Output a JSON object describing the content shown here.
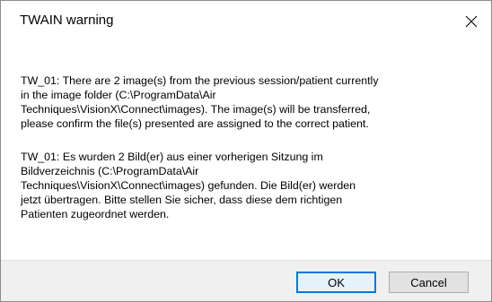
{
  "window": {
    "title": "TWAIN warning",
    "close_icon": "close-icon"
  },
  "message": {
    "english": "TW_01: There are 2 image(s) from the previous session/patient currently\nin the image folder (C:\\ProgramData\\Air\nTechniques\\VisionX\\Connect\\images).  The image(s) will be transferred,\nplease confirm the file(s) presented are assigned to the correct patient.",
    "german": "TW_01: Es wurden 2 Bild(er) aus einer vorherigen Sitzung im\nBildverzeichnis (C:\\ProgramData\\Air\nTechniques\\VisionX\\Connect\\images) gefunden. Die Bild(er) werden\njetzt übertragen. Bitte stellen Sie sicher, dass diese dem richtigen\nPatienten zugeordnet werden."
  },
  "buttons": {
    "ok_label": "OK",
    "cancel_label": "Cancel"
  },
  "colors": {
    "default_button_border": "#0078d7",
    "footer_background": "#f0f0f0"
  }
}
